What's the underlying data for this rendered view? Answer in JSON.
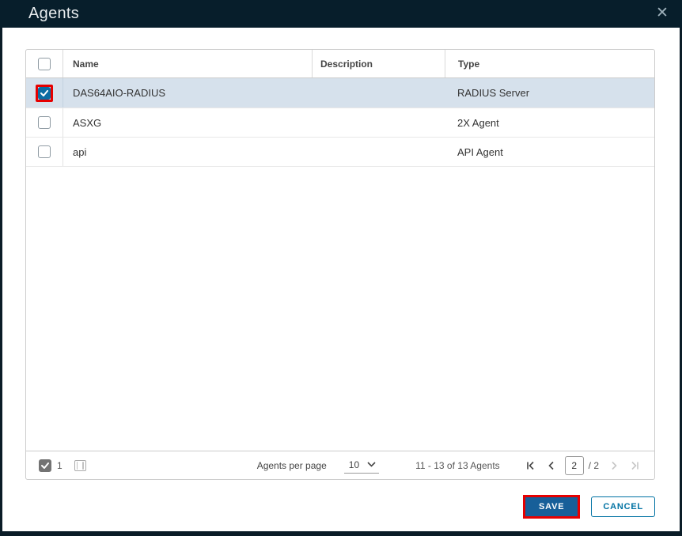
{
  "dialog": {
    "title": "Agents",
    "close_icon": "✕"
  },
  "table": {
    "columns": {
      "name": "Name",
      "description": "Description",
      "type": "Type"
    },
    "rows": [
      {
        "name": "DAS64AIO-RADIUS",
        "description": "",
        "type": "RADIUS Server",
        "checked": true,
        "selected": true
      },
      {
        "name": "ASXG",
        "description": "",
        "type": "2X Agent",
        "checked": false,
        "selected": false
      },
      {
        "name": "api",
        "description": "",
        "type": "API Agent",
        "checked": false,
        "selected": false
      }
    ],
    "footer": {
      "selected_count": "1",
      "per_page_label": "Agents per page",
      "per_page_value": "10",
      "range_text": "11 - 13 of 13 Agents",
      "current_page": "2",
      "total_pages_label": "/ 2"
    }
  },
  "actions": {
    "save_label": "SAVE",
    "cancel_label": "CANCEL"
  },
  "colors": {
    "header_bg": "#071e2b",
    "selected_row_bg": "#d6e1ec",
    "checkbox_checked": "#0c6ca3",
    "annotation_red": "#e60000",
    "primary_button": "#175f99",
    "secondary_button_border": "#0072a3"
  }
}
